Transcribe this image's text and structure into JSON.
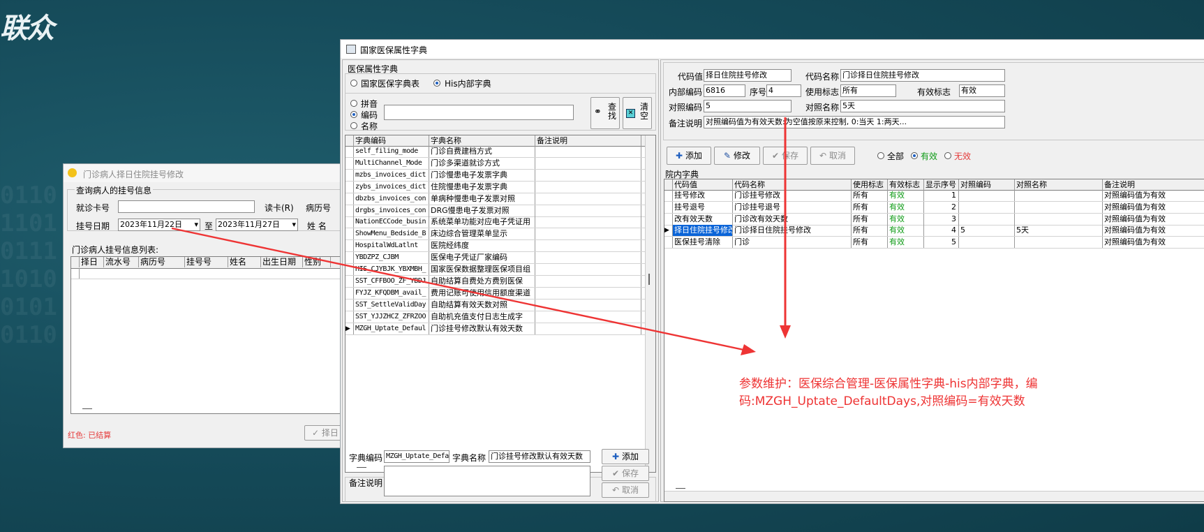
{
  "logo_text": "联众",
  "background_digits": [
    "0110",
    "1101",
    "0111",
    "1010",
    "0101",
    "0110"
  ],
  "left_window": {
    "title": "门诊病人择日住院挂号修改",
    "group_title": "查询病人的挂号信息",
    "card_label": "就诊卡号",
    "read_card_button": "读卡(R)",
    "record_label": "病历号",
    "date_label": "挂号日期",
    "date_from": "2023年11月22日",
    "to_label": "至",
    "date_to": "2023年11月27日",
    "name_label": "姓  名",
    "list_title": "门诊病人挂号信息列表:",
    "columns": [
      "择日",
      "流水号",
      "病历号",
      "挂号号",
      "姓名",
      "出生日期",
      "性别"
    ],
    "legend": "红色: 已结算",
    "bottom_button": "择日"
  },
  "main_window": {
    "title": "国家医保属性字典",
    "left_panel": {
      "group_title": "医保属性字典",
      "radio_national": "国家医保字典表",
      "radio_his": "His内部字典",
      "search_options": [
        "拼音",
        "编码",
        "名称"
      ],
      "search_selected": "编码",
      "search_value": "",
      "find_button": "查找",
      "clear_button": "清空",
      "columns": [
        "字典编码",
        "字典名称",
        "备注说明"
      ],
      "rows": [
        [
          "self_filing_mode",
          "门诊自费建档方式",
          ""
        ],
        [
          "MultiChannel_Mode",
          "门诊多渠道就诊方式",
          ""
        ],
        [
          "mzbs_invoices_dict",
          "门诊慢患电子发票字典",
          ""
        ],
        [
          "zybs_invoices_dict",
          "住院慢患电子发票字典",
          ""
        ],
        [
          "dbzbs_invoices_con",
          "单病种慢患电子发票对照",
          ""
        ],
        [
          "drgbs_invoices_con",
          "DRG慢患电子发票对照",
          ""
        ],
        [
          "NationECCode_busin",
          "系统菜单功能对应电子凭证用",
          ""
        ],
        [
          "ShowMenu_Bedside_B",
          "床边综合管理菜单显示",
          ""
        ],
        [
          "HospitalWdLatlnt",
          "医院经纬度",
          ""
        ],
        [
          "YBDZPZ_CJBM",
          "医保电子凭证厂家编码",
          ""
        ],
        [
          "HIS_CJYBJK_YBXMBH_",
          "国家医保数据整理医保项目组",
          ""
        ],
        [
          "SST_CFFBOO_ZF_YBDJ",
          "自助结算自费处方费别医保",
          ""
        ],
        [
          "FYJZ_KFQDBM_avail_",
          "费用记账可使用信用额度渠道",
          ""
        ],
        [
          "SST_SettleValidDay",
          "自助结算有效天数对照",
          ""
        ],
        [
          "SST_YJJZHCZ_ZFRZOO",
          "自助机充值支付日志生成字",
          ""
        ],
        [
          "MZGH_Uptate_Defaul",
          "门诊挂号修改默认有效天数",
          ""
        ]
      ],
      "current_row": 15,
      "dict_code_label": "字典编码",
      "dict_code_value": "MZGH_Uptate_Defa",
      "dict_name_label": "字典名称",
      "dict_name_value": "门诊挂号修改默认有效天数",
      "remark_label": "备注说明",
      "remark_value": "",
      "add_button": "添加",
      "save_button": "保存",
      "cancel_button": "取消"
    },
    "right_panel": {
      "code_value_label": "代码值",
      "code_value": "择日住院挂号修改",
      "code_name_label": "代码名称",
      "code_name": "门诊择日住院挂号修改",
      "internal_code_label": "内部编码",
      "internal_code": "6816",
      "seq_label": "序号",
      "seq": "4",
      "use_flag_label": "使用标志",
      "use_flag": "所有",
      "valid_flag_label": "有效标志",
      "valid_flag": "有效",
      "map_code_label": "对照编码",
      "map_code": "5",
      "map_name_label": "对照名称",
      "map_name": "5天",
      "remark_label": "备注说明",
      "remark": "对照编码值为有效天数:为空值按原来控制, 0:当天 1:两天...",
      "toolbar": {
        "add": "添加",
        "modify": "修改",
        "save": "保存",
        "cancel": "取消",
        "filter_all": "全部",
        "filter_valid": "有效",
        "filter_invalid": "无效",
        "filter_selected": "有效"
      },
      "grid_title": "院内字典",
      "columns": [
        "代码值",
        "代码名称",
        "使用标志",
        "有效标志",
        "显示序号",
        "对照编码",
        "对照名称",
        "备注说明"
      ],
      "rows": [
        [
          "挂号修改",
          "门诊挂号修改",
          "所有",
          "有效",
          "1",
          "",
          "",
          "对照编码值为有效"
        ],
        [
          "挂号退号",
          "门诊挂号退号",
          "所有",
          "有效",
          "2",
          "",
          "",
          "对照编码值为有效"
        ],
        [
          "改有效天数",
          "门诊改有效天数",
          "所有",
          "有效",
          "3",
          "",
          "",
          "对照编码值为有效"
        ],
        [
          "择日住院挂号修改",
          "门诊择日住院挂号修改",
          "所有",
          "有效",
          "4",
          "5",
          "5天",
          "对照编码值为有效"
        ],
        [
          "医保挂号清除",
          "门诊",
          "所有",
          "有效",
          "5",
          "",
          "",
          "对照编码值为有效"
        ]
      ],
      "current_row": 3
    }
  },
  "annotation": {
    "text_line1": "参数维护：医保综合管理-医保属性字典-his内部字典，编",
    "text_line2": "码:MZGH_Uptate_DefaultDays,对照编码=有效天数",
    "color": "#ee3333"
  }
}
